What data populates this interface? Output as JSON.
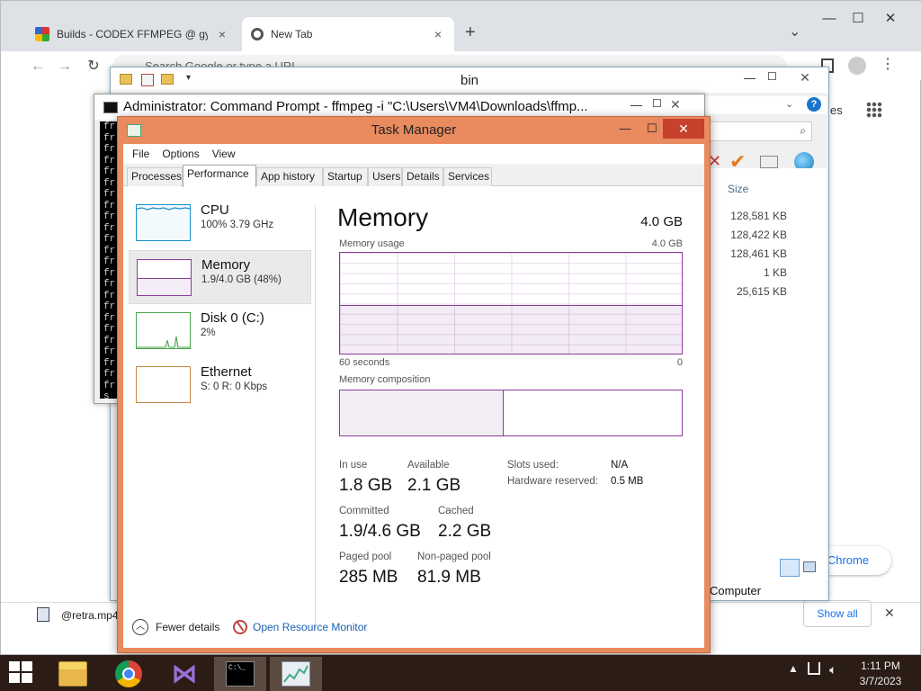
{
  "chrome": {
    "tabs": [
      {
        "title": "Builds - CODEX FFMPEG @ gyan.",
        "close": "×"
      },
      {
        "title": "New Tab",
        "close": "×"
      }
    ],
    "new_tab": "+",
    "tab_search": "⌄",
    "window_controls": {
      "minimize": "—",
      "maximize": "☐",
      "close": "✕"
    },
    "omnibox_placeholder": "Search Google or type a URL",
    "nav": {
      "back": "←",
      "forward": "→",
      "reload": "↻"
    },
    "right_text_es": "es",
    "chrome_link": "e Chrome",
    "download_name": "@retra.mp4",
    "show_all": "Show all",
    "download_close": "✕"
  },
  "explorer": {
    "title": "bin",
    "column_size": "Size",
    "sizes": [
      "128,581 KB",
      "128,422 KB",
      "128,461 KB",
      "1 KB",
      "25,615 KB"
    ],
    "status_computer": "Computer",
    "help": "?"
  },
  "cmd": {
    "title": "Administrator:  Command Prompt - ffmpeg  -i \"C:\\Users\\VM4\\Downloads\\ffmp...",
    "lines": "fr fr fr fr fr fr fr fr fr fr fr fr fr fr fr fr fr fr fr fr fr fr fr fr s"
  },
  "taskmgr": {
    "title": "Task Manager",
    "menu": [
      "File",
      "Options",
      "View"
    ],
    "tabs": [
      "Processes",
      "Performance",
      "App history",
      "Startup",
      "Users",
      "Details",
      "Services"
    ],
    "active_tab": "Performance",
    "sidebar": [
      {
        "name": "CPU",
        "sub": "100%  3.79 GHz"
      },
      {
        "name": "Memory",
        "sub": "1.9/4.0 GB (48%)"
      },
      {
        "name": "Disk 0 (C:)",
        "sub": "2%"
      },
      {
        "name": "Ethernet",
        "sub": "S: 0 R: 0 Kbps"
      }
    ],
    "panel": {
      "title": "Memory",
      "total": "4.0 GB",
      "usage_label": "Memory usage",
      "usage_max": "4.0 GB",
      "time_left": "60 seconds",
      "time_right": "0",
      "composition_label": "Memory composition",
      "usage_fraction": 0.48,
      "stats": {
        "in_use_label": "In use",
        "in_use": "1.8 GB",
        "available_label": "Available",
        "available": "2.1 GB",
        "committed_label": "Committed",
        "committed": "1.9/4.6 GB",
        "cached_label": "Cached",
        "cached": "2.2 GB",
        "paged_label": "Paged pool",
        "paged": "285 MB",
        "nonpaged_label": "Non-paged pool",
        "nonpaged": "81.9 MB",
        "slots_label": "Slots used:",
        "slots": "N/A",
        "hw_label": "Hardware reserved:",
        "hw": "0.5 MB"
      }
    },
    "footer": {
      "fewer_details": "Fewer details",
      "resource_monitor": "Open Resource Monitor"
    }
  },
  "taskbar": {
    "time": "1:11 PM",
    "date": "3/7/2023",
    "apps": [
      "file-explorer",
      "chrome",
      "visual-studio",
      "command-prompt",
      "task-manager"
    ]
  },
  "colors": {
    "memory_accent": "#8b3c9b",
    "cpu_accent": "#1a8fc9",
    "disk_accent": "#4aa34a",
    "ethernet_accent": "#c8874a",
    "taskmgr_frame": "#e98a5f"
  }
}
